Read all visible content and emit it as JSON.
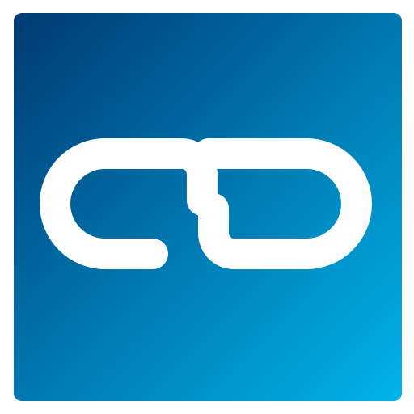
{
  "app_icon": {
    "icon": "chain-link-icon",
    "colors": {
      "gradient_start": "#003a73",
      "gradient_end": "#00b4eb",
      "glyph": "#ffffff"
    }
  }
}
